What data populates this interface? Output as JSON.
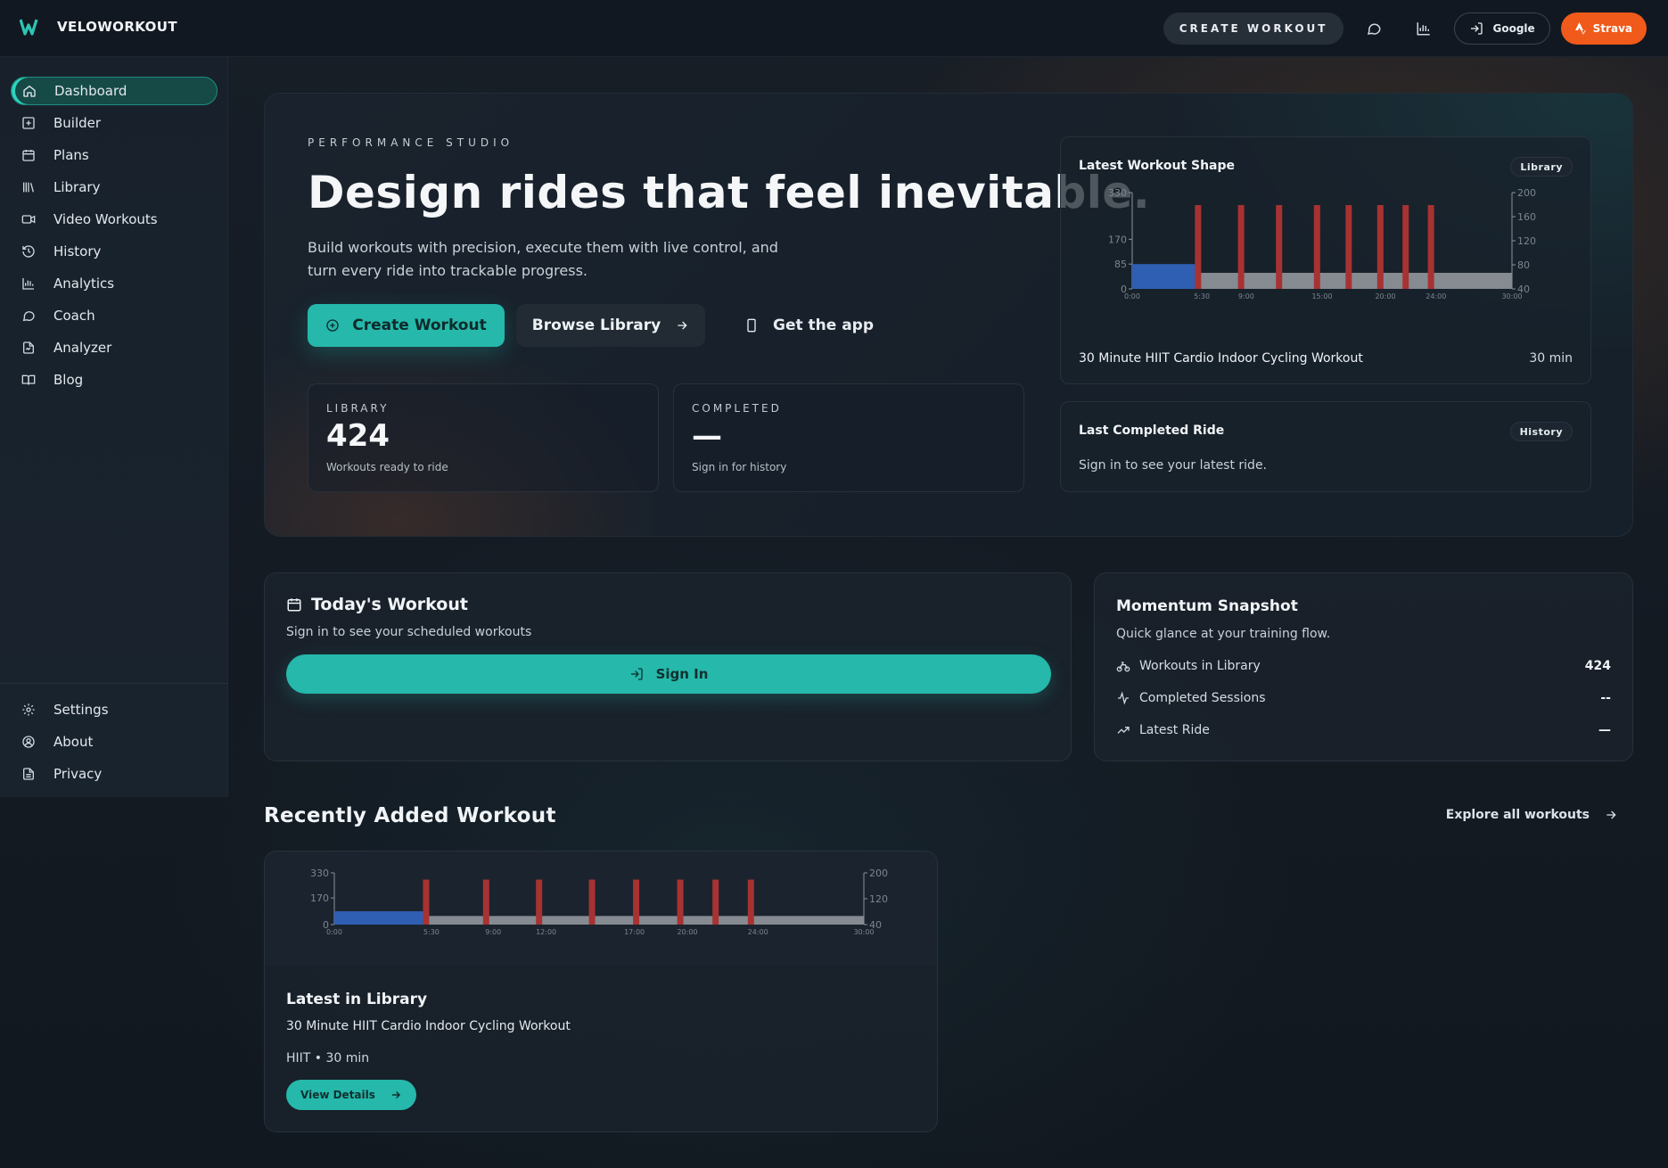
{
  "app": {
    "name": "VELOWORKOUT",
    "logo_letter": "W"
  },
  "topbar": {
    "create_label": "CREATE WORKOUT",
    "google_label": "Google",
    "strava_label": "Strava",
    "strava_color": "#f05a1a",
    "icons": [
      "chat-icon",
      "analytics-icon",
      "login-icon",
      "strava-icon"
    ]
  },
  "sidebar": {
    "items": [
      {
        "label": "Dashboard",
        "icon": "home-icon",
        "active": true
      },
      {
        "label": "Builder",
        "icon": "plus-square-icon"
      },
      {
        "label": "Plans",
        "icon": "calendar-icon"
      },
      {
        "label": "Library",
        "icon": "library-icon"
      },
      {
        "label": "Video Workouts",
        "icon": "video-icon"
      },
      {
        "label": "History",
        "icon": "history-icon"
      },
      {
        "label": "Analytics",
        "icon": "bar-chart-icon"
      },
      {
        "label": "Coach",
        "icon": "chat-icon"
      },
      {
        "label": "Analyzer",
        "icon": "file-analyze-icon"
      },
      {
        "label": "Blog",
        "icon": "book-icon"
      }
    ],
    "footer_items": [
      {
        "label": "Settings",
        "icon": "gear-icon"
      },
      {
        "label": "About",
        "icon": "user-circle-icon"
      },
      {
        "label": "Privacy",
        "icon": "document-icon"
      }
    ]
  },
  "hero": {
    "eyebrow": "PERFORMANCE STUDIO",
    "title": "Design rides that feel inevitable.",
    "subtitle": "Build workouts with precision, execute them with live control, and turn every ride into trackable progress.",
    "primary_cta": "Create Workout",
    "secondary_cta": "Browse Library",
    "ghost_cta": "Get the app",
    "stats": [
      {
        "label": "LIBRARY",
        "value": "424",
        "note": "Workouts ready to ride"
      },
      {
        "label": "COMPLETED",
        "value": "—",
        "note": "Sign in for history"
      }
    ],
    "latest_shape": {
      "title": "Latest Workout Shape",
      "pill": "Library",
      "workout_name": "30 Minute HIIT Cardio Indoor Cycling Workout",
      "duration": "30 min"
    },
    "last_ride": {
      "title": "Last Completed Ride",
      "pill": "History",
      "text": "Sign in to see your latest ride."
    }
  },
  "today": {
    "title": "Today's Workout",
    "subtitle": "Sign in to see your scheduled workouts",
    "signin_label": "Sign In"
  },
  "momentum": {
    "title": "Momentum Snapshot",
    "subtitle": "Quick glance at your training flow.",
    "rows": [
      {
        "label": "Workouts in Library",
        "value": "424",
        "icon": "bike-icon"
      },
      {
        "label": "Completed Sessions",
        "value": "--",
        "icon": "activity-icon"
      },
      {
        "label": "Latest Ride",
        "value": "—",
        "icon": "trend-icon"
      }
    ]
  },
  "recent": {
    "section_title": "Recently Added Workout",
    "explore_label": "Explore all workouts",
    "card_title": "Latest in Library",
    "workout_name": "30 Minute HIIT Cardio Indoor Cycling Workout",
    "meta": "HIIT • 30 min",
    "view_label": "View Details"
  },
  "chart_data": [
    {
      "type": "area",
      "title": "",
      "x_ticks": [
        "0:00",
        "5:30",
        "9:00",
        "15:00",
        "20:00",
        "24:00",
        "30:00"
      ],
      "y_left_ticks": [
        "330",
        "170",
        "85",
        "0"
      ],
      "y_right_ticks": [
        "200",
        "160",
        "120",
        "80",
        "40"
      ],
      "xlim_min": [
        0,
        30
      ],
      "segments": [
        {
          "start": 0,
          "end": 5.1,
          "power": 85,
          "zone_color": "#2f5fb3"
        },
        {
          "start": 5.1,
          "end": 30,
          "power": 55,
          "zone_color": "#868b92"
        }
      ],
      "intervals_min": [
        5.2,
        8.6,
        11.6,
        14.6,
        17.1,
        19.6,
        21.6,
        23.6
      ],
      "interval_power": 170,
      "interval_color": "#a83232"
    },
    {
      "type": "area",
      "title": "",
      "x_ticks": [
        "0:00",
        "5:30",
        "9:00",
        "12:00",
        "17:00",
        "20:00",
        "24:00",
        "30:00"
      ],
      "y_left_ticks": [
        "330",
        "170",
        "0"
      ],
      "y_right_ticks": [
        "200",
        "120",
        "40"
      ],
      "xlim_min": [
        0,
        30
      ],
      "segments": [
        {
          "start": 0,
          "end": 5.1,
          "power": 85,
          "zone_color": "#2f5fb3"
        },
        {
          "start": 5.1,
          "end": 30,
          "power": 55,
          "zone_color": "#868b92"
        }
      ],
      "intervals_min": [
        5.2,
        8.6,
        11.6,
        14.6,
        17.1,
        19.6,
        21.6,
        23.6
      ],
      "interval_power": 170,
      "interval_color": "#a83232"
    }
  ]
}
